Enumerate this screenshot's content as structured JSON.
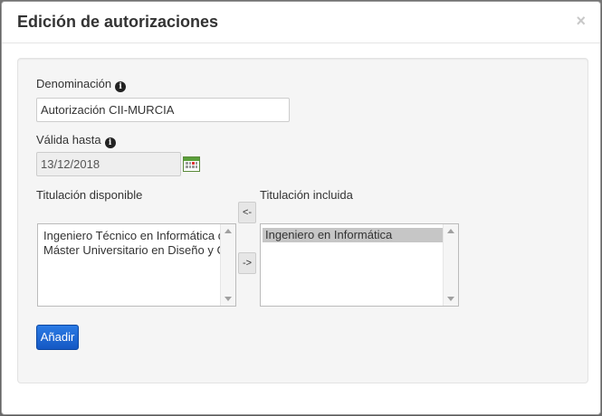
{
  "dialog": {
    "title": "Edición de autorizaciones",
    "close_label": "×"
  },
  "form": {
    "denominacion_label": "Denominación",
    "denominacion_value": "Autorización CII-MURCIA",
    "valida_label": "Válida hasta",
    "valida_value": "13/12/2018",
    "disponible_label": "Titulación disponible",
    "incluida_label": "Titulación incluida",
    "disponible_items": [
      "Ingeniero Técnico en Informática de",
      "Máster Universitario en Diseño y Ge"
    ],
    "incluida_items": [
      "Ingeniero en Informática"
    ],
    "move_left_label": "<-",
    "move_right_label": "->",
    "add_label": "Añadir",
    "info_glyph": "i"
  }
}
